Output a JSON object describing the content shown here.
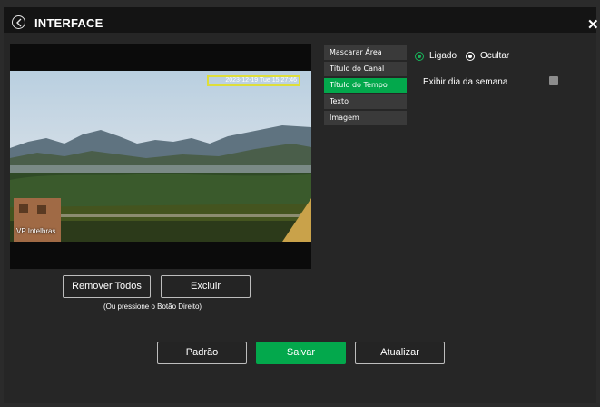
{
  "header": {
    "title": "INTERFACE"
  },
  "video": {
    "overlay_text": "2023-12-19 Tue 15:27:46",
    "channel_name": "VP Intelbras"
  },
  "osd_menu": {
    "items": [
      {
        "label": "Mascarar Área"
      },
      {
        "label": "Título do Canal"
      },
      {
        "label": "Título do Tempo"
      },
      {
        "label": "Texto"
      },
      {
        "label": "Imagem"
      }
    ],
    "active": "Título do Tempo"
  },
  "display": {
    "on_label": "Ligado",
    "hide_label": "Ocultar",
    "weekday_label": "Exibir dia da semana"
  },
  "region_actions": {
    "remove_all_label": "Remover Todos",
    "delete_label": "Excluir",
    "hint": "(Ou pressione o Botão Direito)"
  },
  "footer": {
    "default_label": "Padrão",
    "save_label": "Salvar",
    "refresh_label": "Atualizar"
  },
  "colors": {
    "accent": "#03a84c",
    "overlay_border": "#dede3a"
  }
}
